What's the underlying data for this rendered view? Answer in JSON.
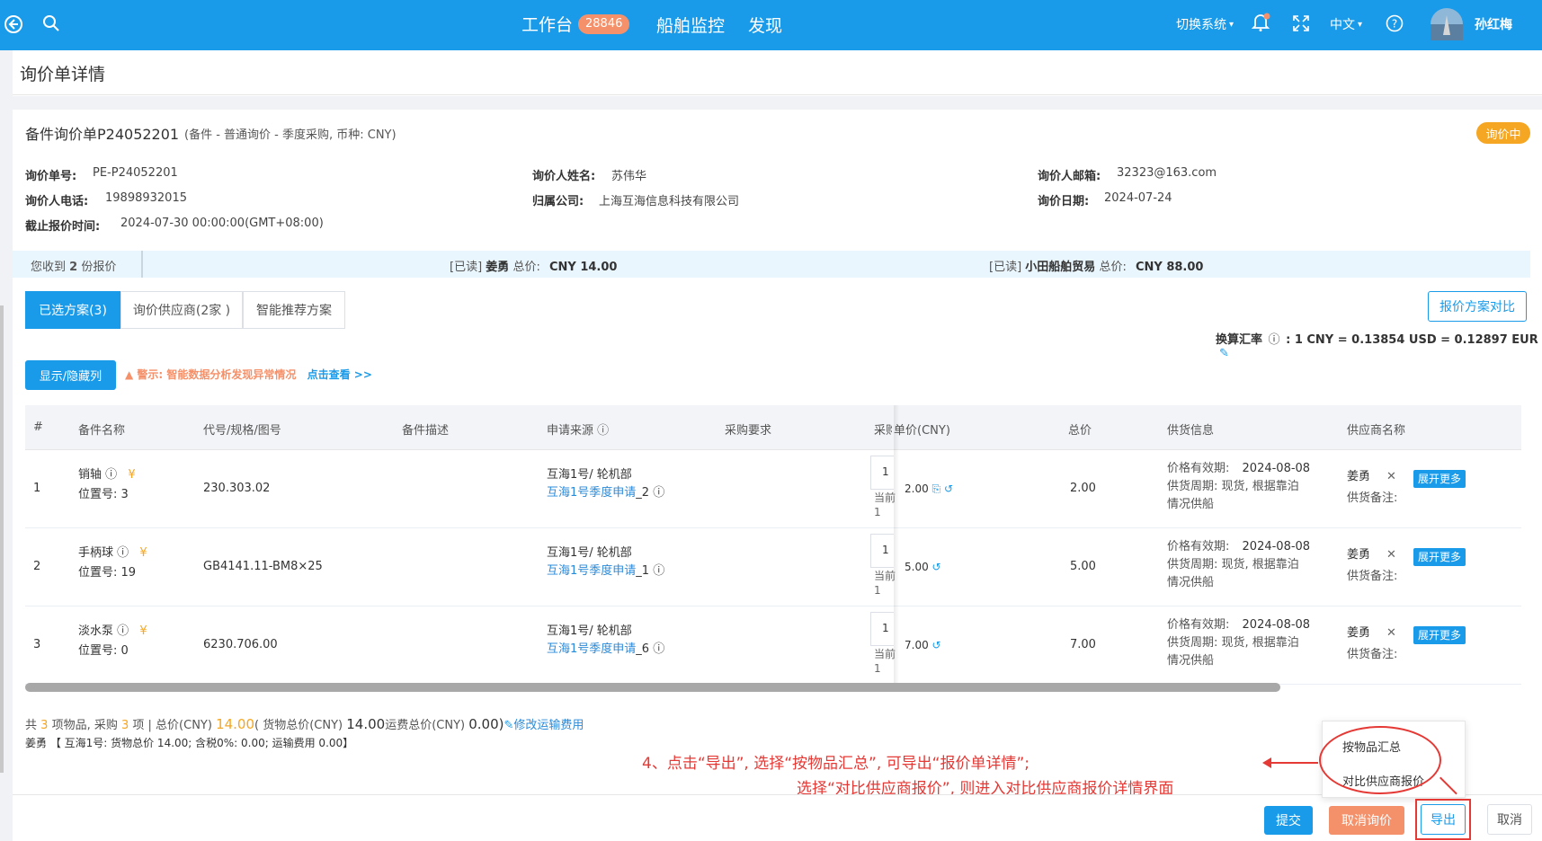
{
  "topbar": {
    "nav_workbench": "工作台",
    "workbench_count": "28846",
    "nav_ship_monitor": "船舶监控",
    "nav_discover": "发现",
    "switch_system": "切换系统",
    "language": "中文",
    "username": "孙红梅"
  },
  "page_title": "询价单详情",
  "inquiry": {
    "title": "备件询价单P24052201",
    "subtitle": "(备件 - 普通询价 - 季度采购, 币种: CNY)",
    "status": "询价中",
    "fields": {
      "no_label": "询价单号:",
      "no_value": "PE-P24052201",
      "name_label": "询价人姓名:",
      "name_value": "苏伟华",
      "email_label": "询价人邮箱:",
      "email_value": "32323@163.com",
      "phone_label": "询价人电话:",
      "phone_value": "19898932015",
      "company_label": "归属公司:",
      "company_value": "上海互海信息科技有限公司",
      "date_label": "询价日期:",
      "date_value": "2024-07-24",
      "deadline_label": "截止报价时间:",
      "deadline_value": "2024-07-30 00:00:00(GMT+08:00)"
    }
  },
  "quotes_bar": {
    "received_prefix": "您收到",
    "received_count": "2",
    "received_suffix": "份报价",
    "q1_read": "[已读]",
    "q1_name": "姜勇",
    "q1_total_label": "总价:",
    "q1_total": "CNY  14.00",
    "q2_read": "[已读]",
    "q2_name": "小田船舶贸易",
    "q2_total_label": "总价:",
    "q2_total": "CNY  88.00"
  },
  "tabs": [
    "已选方案(3)",
    "询价供应商(2家 )",
    "智能推荐方案"
  ],
  "compare_button": "报价方案对比",
  "exchange": {
    "label": "换算汇率",
    "value": ":  1 CNY = 0.13854 USD = 0.12897 EUR"
  },
  "show_hide_button": "显示/隐藏列",
  "warning": {
    "text": "警示: 智能数据分析发现异常情况",
    "link": "点击查看 >>"
  },
  "table": {
    "headers": [
      "#",
      "备件名称",
      "代号/规格/图号",
      "备件描述",
      "申请来源",
      "采购要求",
      "采购",
      "单价(CNY)",
      "总价",
      "供货信息",
      "供应商名称"
    ],
    "rows": [
      {
        "idx": "1",
        "name": "销轴",
        "pos_label": "位置号:",
        "pos": "3",
        "code": "230.303.02",
        "source": "互海1号/ 轮机部",
        "source_link": "互海1号季度申请",
        "source_suffix": "_2",
        "qty": "1",
        "qty_cur_label": "当前",
        "qty_cur": "1",
        "unit_price": "2.00",
        "total": "2.00",
        "valid_label": "价格有效期:",
        "valid": "2024-08-08",
        "period_label": "供货周期:",
        "period": "现货, 根据靠泊",
        "period2": "情况供船",
        "supplier": "姜勇",
        "note_label": "供货备注:",
        "expand": "展开更多"
      },
      {
        "idx": "2",
        "name": "手柄球",
        "pos_label": "位置号:",
        "pos": "19",
        "code": "GB4141.11-BM8×25",
        "source": "互海1号/ 轮机部",
        "source_link": "互海1号季度申请",
        "source_suffix": "_1",
        "qty": "1",
        "qty_cur_label": "当前",
        "qty_cur": "1",
        "unit_price": "5.00",
        "total": "5.00",
        "valid_label": "价格有效期:",
        "valid": "2024-08-08",
        "period_label": "供货周期:",
        "period": "现货, 根据靠泊",
        "period2": "情况供船",
        "supplier": "姜勇",
        "note_label": "供货备注:",
        "expand": "展开更多"
      },
      {
        "idx": "3",
        "name": "淡水泵",
        "pos_label": "位置号:",
        "pos": "0",
        "code": "6230.706.00",
        "source": "互海1号/ 轮机部",
        "source_link": "互海1号季度申请",
        "source_suffix": "_6",
        "qty": "1",
        "qty_cur_label": "当前",
        "qty_cur": "1",
        "unit_price": "7.00",
        "total": "7.00",
        "valid_label": "价格有效期:",
        "valid": "2024-08-08",
        "period_label": "供货周期:",
        "period": "现货, 根据靠泊",
        "period2": "情况供船",
        "supplier": "姜勇",
        "note_label": "供货备注:",
        "expand": "展开更多"
      }
    ]
  },
  "summary": {
    "line1_a": "共",
    "items_count": "3",
    "line1_b": "项物品, 采购",
    "purchase_count": "3",
    "line1_c": "项  |   总价(CNY)",
    "total_price": "14.00",
    "line1_d": "( 货物总价(CNY)",
    "goods_total": "14.00",
    "line1_e": "运费总价(CNY)",
    "freight_total": "0.00)",
    "modify_freight": "修改运输费用",
    "line2": "姜勇 【 互海1号: 货物总价  14.00; 含税0%: 0.00; 运输费用  0.00】"
  },
  "annotation": {
    "line1": "4、点击“导出”, 选择“按物品汇总”, 可导出“报价单详情”;",
    "line2": "选择“对比供应商报价”, 则进入对比供应商报价详情界面"
  },
  "dropdown": {
    "item1": "按物品汇总",
    "item2": "对比供应商报价"
  },
  "footer": {
    "submit": "提交",
    "cancel_inquiry": "取消询价",
    "export": "导出",
    "cancel": "取消"
  },
  "colors": {
    "primary": "#1a9bea",
    "accent_orange": "#f5a623",
    "danger_soft": "#f5916a",
    "annotation_red": "#e53935",
    "link_blue": "#2b8ad8"
  }
}
